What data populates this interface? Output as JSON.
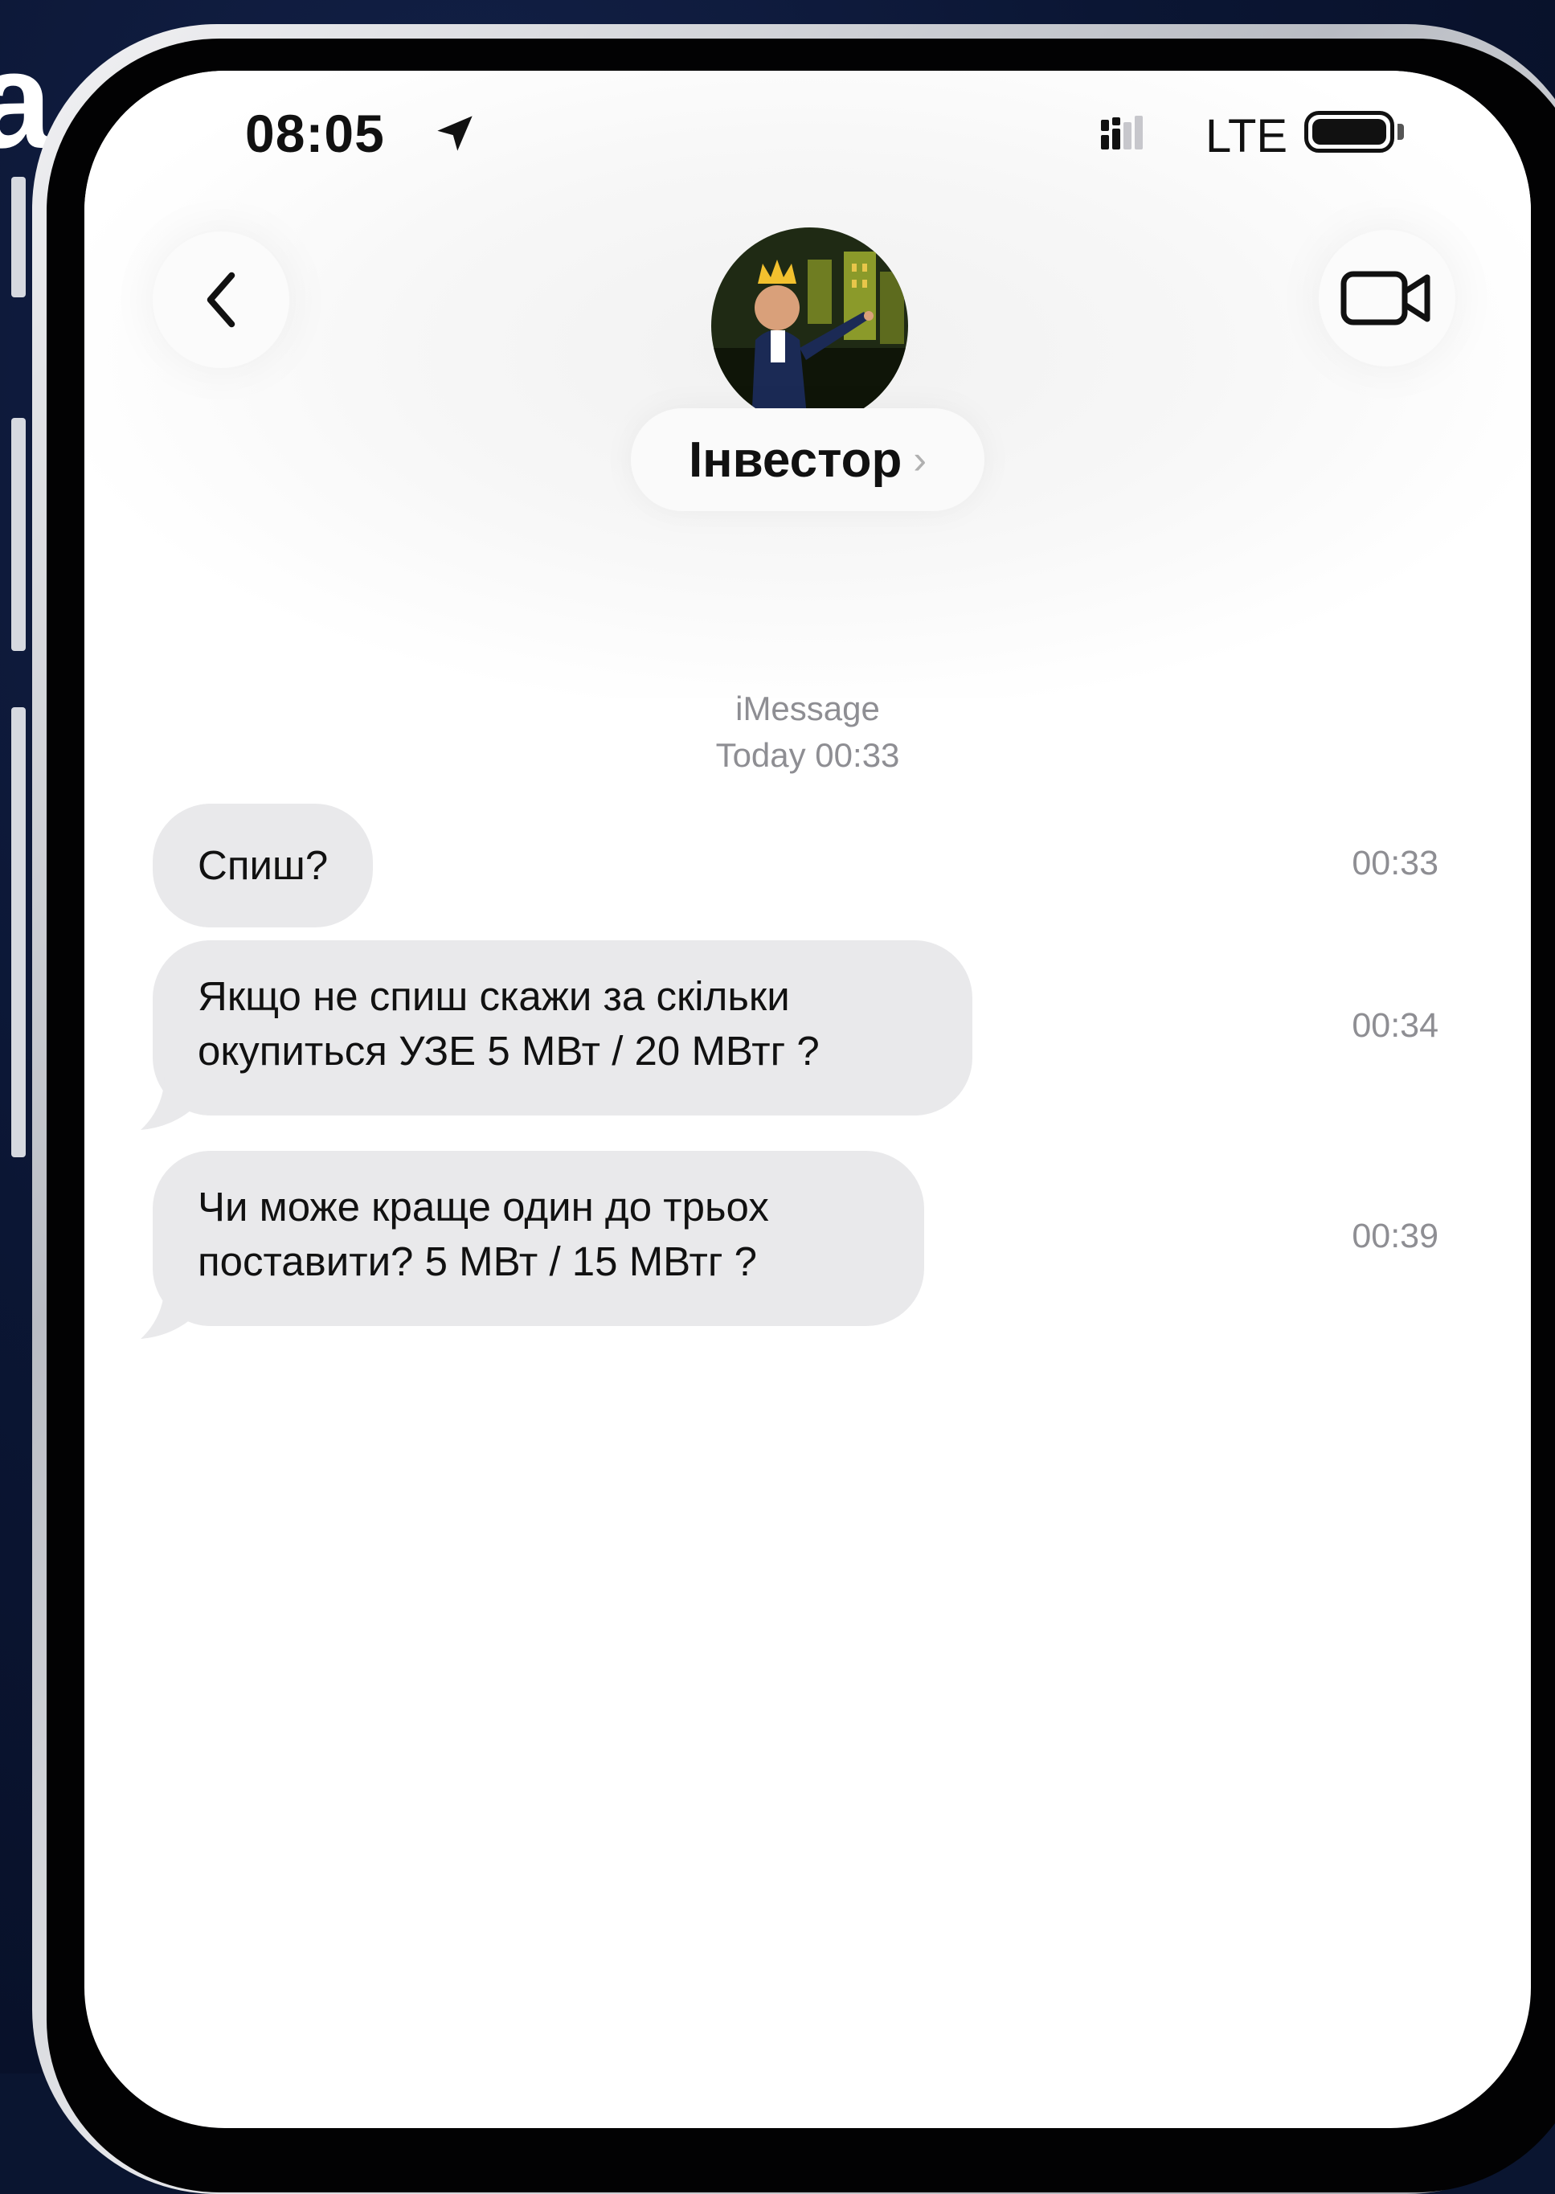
{
  "background": {
    "partial_text": "a"
  },
  "status_bar": {
    "time": "08:05",
    "network": "LTE"
  },
  "header": {
    "contact_name": "Інвестор",
    "chevron": "›"
  },
  "conversation": {
    "service": "iMessage",
    "date_label": "Today 00:33",
    "messages": [
      {
        "text": "Спиш?",
        "time": "00:33"
      },
      {
        "text": "Якщо не спиш скажи за скільки окупиться УЗЕ 5 МВт / 20 МВтг ?",
        "time": "00:34"
      },
      {
        "text": "Чи може краще один до трьох поставити? 5 МВт / 15 МВтг ?",
        "time": "00:39"
      }
    ]
  },
  "colors": {
    "bubble_incoming": "#e9e9eb",
    "timestamp_gray": "#8e8e93",
    "screen_bg": "#ffffff"
  },
  "icons": [
    "location-arrow-icon",
    "signal-icon",
    "battery-icon",
    "back-chevron-icon",
    "video-camera-icon",
    "contact-avatar"
  ]
}
